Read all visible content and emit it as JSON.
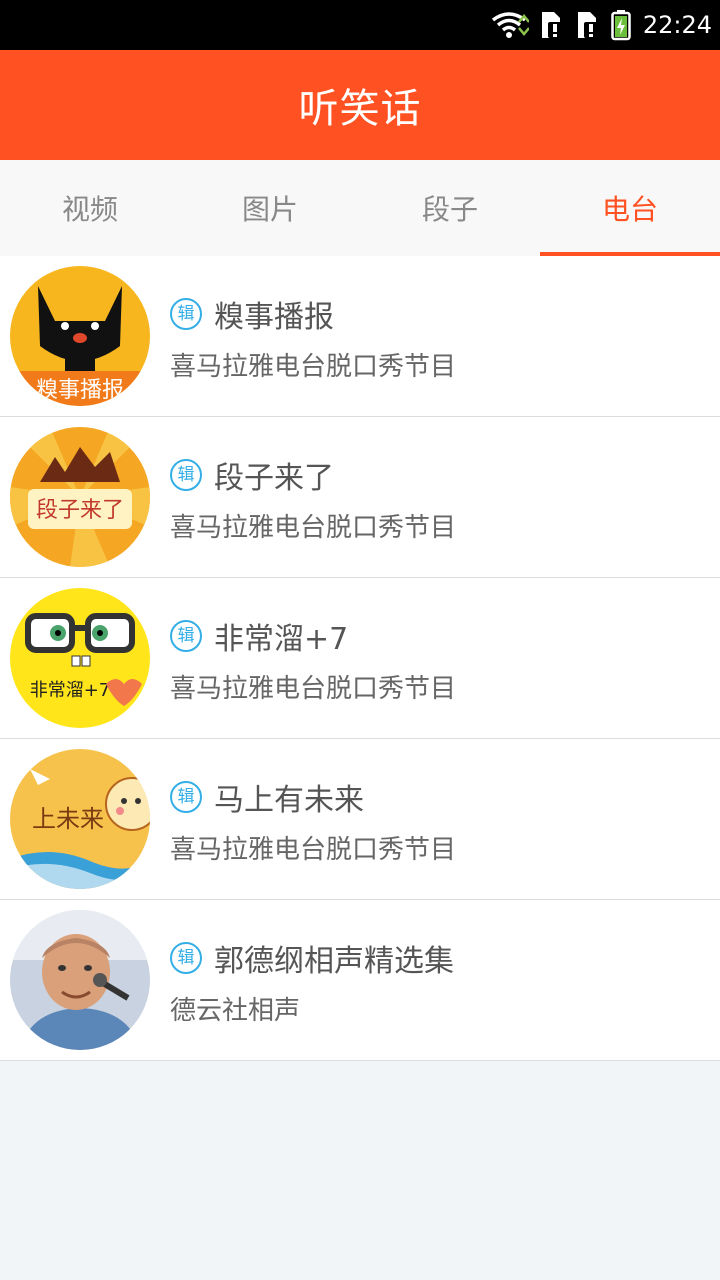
{
  "status_bar": {
    "time": "22:24",
    "icons": [
      "wifi-icon",
      "sim-card-alert-icon",
      "sim-card-alert-icon",
      "battery-charging-icon"
    ]
  },
  "header": {
    "title": "听笑话"
  },
  "tabs": [
    {
      "label": "视频",
      "active": false
    },
    {
      "label": "图片",
      "active": false
    },
    {
      "label": "段子",
      "active": false
    },
    {
      "label": "电台",
      "active": true
    }
  ],
  "colors": {
    "accent": "#ff5122",
    "badge": "#33aee6"
  },
  "albums": [
    {
      "badge": "辑",
      "name": "糗事播报",
      "subtitle": "喜马拉雅电台脱口秀节目",
      "cover_text": "糗事播报"
    },
    {
      "badge": "辑",
      "name": "段子来了",
      "subtitle": "喜马拉雅电台脱口秀节目",
      "cover_text": "段子来了"
    },
    {
      "badge": "辑",
      "name": "非常溜+7",
      "subtitle": "喜马拉雅电台脱口秀节目",
      "cover_text": "非常溜+7"
    },
    {
      "badge": "辑",
      "name": "马上有未来",
      "subtitle": "喜马拉雅电台脱口秀节目",
      "cover_text": "上未来"
    },
    {
      "badge": "辑",
      "name": "郭德纲相声精选集",
      "subtitle": "德云社相声",
      "cover_text": ""
    }
  ]
}
